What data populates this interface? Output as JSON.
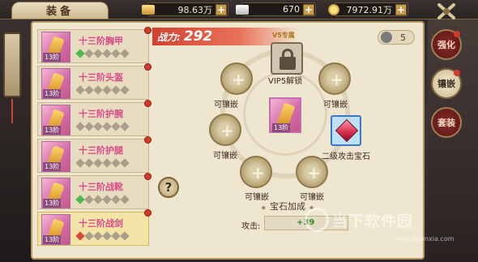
{
  "header": {
    "title": "装备",
    "resources": [
      {
        "icon": "gold-ingot-icon",
        "value": "98.63万"
      },
      {
        "icon": "silver-ingot-icon",
        "value": "670"
      },
      {
        "icon": "coin-icon",
        "value": "7972.91万"
      }
    ]
  },
  "equipment_list": [
    {
      "name": "十三阶胸甲",
      "level": "13阶",
      "gems": [
        "green",
        "gray",
        "gray",
        "gray",
        "gray",
        "gray"
      ],
      "has_dot": true
    },
    {
      "name": "十三阶头盔",
      "level": "13阶",
      "gems": [
        "gray",
        "gray",
        "gray",
        "gray",
        "gray",
        "gray"
      ],
      "has_dot": true
    },
    {
      "name": "十三阶护腕",
      "level": "13阶",
      "gems": [
        "gray",
        "gray",
        "gray",
        "gray",
        "gray",
        "gray"
      ],
      "has_dot": true
    },
    {
      "name": "十三阶护腿",
      "level": "13阶",
      "gems": [
        "gray",
        "gray",
        "gray",
        "gray",
        "gray",
        "gray"
      ],
      "has_dot": true
    },
    {
      "name": "十三阶战靴",
      "level": "13阶",
      "gems": [
        "green",
        "gray",
        "gray",
        "gray",
        "gray",
        "gray"
      ],
      "has_dot": true
    },
    {
      "name": "十三阶战剑",
      "level": "13阶",
      "gems": [
        "red",
        "gray",
        "gray",
        "gray",
        "gray",
        "gray"
      ],
      "has_dot": true,
      "selected": true
    }
  ],
  "power": {
    "label": "战力:",
    "value": "292"
  },
  "vip_tag": "V5专属",
  "gem_count": "5",
  "slots": {
    "lock_label": "VIP5解锁",
    "empty_label": "可镶嵌",
    "gem_label": "二级攻击宝石",
    "center_level": "13阶"
  },
  "help": "?",
  "bonus": {
    "title": "宝石加成",
    "attack_label": "攻击:",
    "attack_value": "+39"
  },
  "tabs": [
    {
      "label": "强化",
      "active": false
    },
    {
      "label": "镶嵌",
      "active": true
    },
    {
      "label": "套装",
      "active": false
    }
  ],
  "watermark": {
    "text": "当下软件园",
    "url": "www.downxia.com"
  }
}
